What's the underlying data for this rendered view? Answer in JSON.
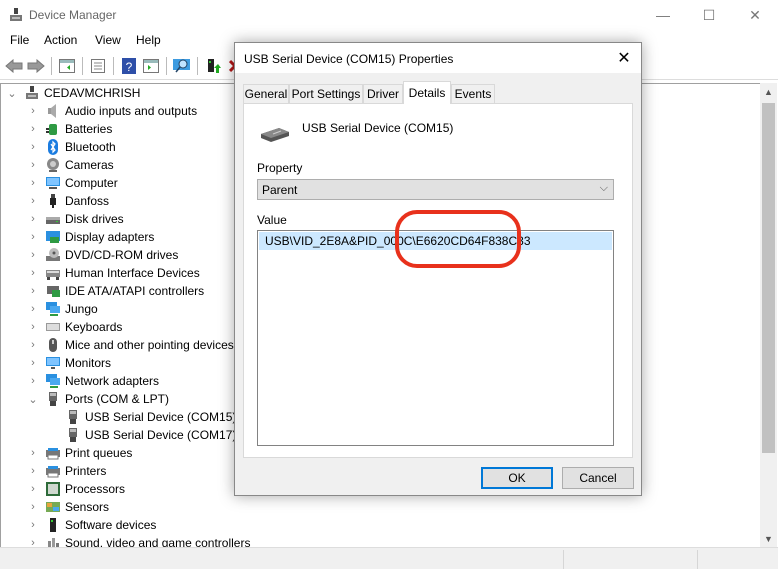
{
  "window": {
    "title": "Device Manager",
    "controls": {
      "minimize": "—",
      "maximize": "☐",
      "close": "✕"
    }
  },
  "menu": [
    "File",
    "Action",
    "View",
    "Help"
  ],
  "toolbar": {
    "buttons": [
      "back-icon",
      "forward-icon",
      "show-hide-console-tree-icon",
      "properties-icon",
      "help-icon",
      "show-hide-action-pane-icon",
      "scan-hardware-icon",
      "update-driver-icon",
      "uninstall-icon"
    ]
  },
  "tree": {
    "root": "CEDAVMCHRISH",
    "items": [
      {
        "label": "Audio inputs and outputs",
        "icon": "speaker-icon",
        "expanded": false
      },
      {
        "label": "Batteries",
        "icon": "battery-icon",
        "expanded": false
      },
      {
        "label": "Bluetooth",
        "icon": "bluetooth-icon",
        "expanded": false
      },
      {
        "label": "Cameras",
        "icon": "camera-icon",
        "expanded": false
      },
      {
        "label": "Computer",
        "icon": "computer-icon",
        "expanded": false
      },
      {
        "label": "Danfoss",
        "icon": "usb-plug-icon",
        "expanded": false
      },
      {
        "label": "Disk drives",
        "icon": "disk-drive-icon",
        "expanded": false
      },
      {
        "label": "Display adapters",
        "icon": "display-adapter-icon",
        "expanded": false
      },
      {
        "label": "DVD/CD-ROM drives",
        "icon": "dvd-drive-icon",
        "expanded": false
      },
      {
        "label": "Human Interface Devices",
        "icon": "hid-icon",
        "expanded": false
      },
      {
        "label": "IDE ATA/ATAPI controllers",
        "icon": "ide-controller-icon",
        "expanded": false
      },
      {
        "label": "Jungo",
        "icon": "network-icon",
        "expanded": false
      },
      {
        "label": "Keyboards",
        "icon": "keyboard-icon",
        "expanded": false
      },
      {
        "label": "Mice and other pointing devices",
        "icon": "mouse-icon",
        "expanded": false
      },
      {
        "label": "Monitors",
        "icon": "monitor-icon",
        "expanded": false
      },
      {
        "label": "Network adapters",
        "icon": "network-adapter-icon",
        "expanded": false
      },
      {
        "label": "Ports (COM & LPT)",
        "icon": "port-icon",
        "expanded": true
      },
      {
        "label": "USB Serial Device (COM15)",
        "icon": "port-icon",
        "child": true
      },
      {
        "label": "USB Serial Device (COM17)",
        "icon": "port-icon",
        "child": true
      },
      {
        "label": "Print queues",
        "icon": "printer-icon",
        "expanded": false
      },
      {
        "label": "Printers",
        "icon": "printer-icon",
        "expanded": false
      },
      {
        "label": "Processors",
        "icon": "processor-icon",
        "expanded": false
      },
      {
        "label": "Sensors",
        "icon": "sensor-icon",
        "expanded": false
      },
      {
        "label": "Software devices",
        "icon": "software-device-icon",
        "expanded": false
      },
      {
        "label": "Sound, video and game controllers",
        "icon": "sound-icon",
        "expanded": false
      }
    ]
  },
  "dialog": {
    "title": "USB Serial Device (COM15) Properties",
    "tabs": [
      "General",
      "Port Settings",
      "Driver",
      "Details",
      "Events"
    ],
    "active_tab": "Details",
    "device_name": "USB Serial Device (COM15)",
    "property_label": "Property",
    "property_value": "Parent",
    "value_label": "Value",
    "values": [
      "USB\\VID_2E8A&PID_000C\\E6620CD64F838C33"
    ],
    "ok_label": "OK",
    "cancel_label": "Cancel"
  },
  "annotation": {
    "color": "#e8311c",
    "shape": "rounded-rectangle"
  }
}
